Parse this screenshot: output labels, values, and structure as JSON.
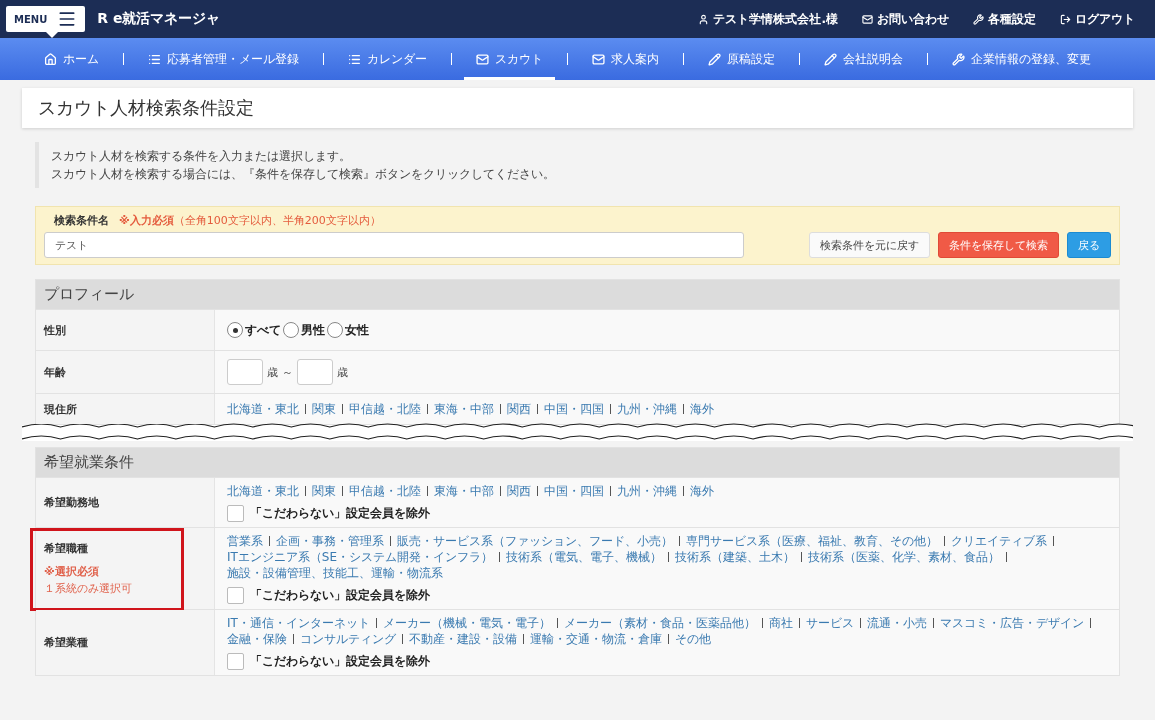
{
  "header": {
    "menu_label": "MENU",
    "app_title": "R e就活マネージャ",
    "links": [
      {
        "label": "テスト学情株式会社.様"
      },
      {
        "label": "お問い合わせ"
      },
      {
        "label": "各種設定"
      },
      {
        "label": "ログアウト"
      }
    ]
  },
  "nav": [
    {
      "label": "ホーム",
      "selected": false
    },
    {
      "label": "応募者管理・メール登録",
      "selected": false
    },
    {
      "label": "カレンダー",
      "selected": false
    },
    {
      "label": "スカウト",
      "selected": true
    },
    {
      "label": "求人案内",
      "selected": false
    },
    {
      "label": "原稿設定",
      "selected": false
    },
    {
      "label": "会社説明会",
      "selected": false
    },
    {
      "label": "企業情報の登録、変更",
      "selected": false
    }
  ],
  "page_title": "スカウト人材検索条件設定",
  "notes": [
    "スカウト人材を検索する条件を入力または選択します。",
    "スカウト人材を検索する場合には、『条件を保存して検索』ボタンをクリックしてください。"
  ],
  "search_name": {
    "label": "検索条件名",
    "required": "※入力必須",
    "hint": "（全角100文字以内、半角200文字以内）",
    "value": "テスト"
  },
  "buttons": [
    {
      "kind": "default",
      "label": "検索条件を元に戻す"
    },
    {
      "kind": "danger",
      "label": "条件を保存して検索"
    },
    {
      "kind": "primary",
      "label": "戻る"
    }
  ],
  "sections": [
    {
      "title": "プロフィール",
      "rows": [
        {
          "kind": "radio",
          "label": "性別",
          "options": [
            {
              "label": "すべて",
              "selected": true
            },
            {
              "label": "男性",
              "selected": false
            },
            {
              "label": "女性",
              "selected": false
            }
          ]
        },
        {
          "kind": "range",
          "label": "年齢",
          "from_unit": "歳",
          "separator": "～",
          "to_unit": "歳"
        },
        {
          "kind": "links",
          "label": "現住所",
          "links": [
            "北海道・東北",
            "関東",
            "甲信越・北陸",
            "東海・中部",
            "関西",
            "中国・四国",
            "九州・沖縄",
            "海外"
          ]
        }
      ]
    },
    {
      "title": "希望就業条件",
      "rows": [
        {
          "kind": "links",
          "label": "希望勤務地",
          "links": [
            "北海道・東北",
            "関東",
            "甲信越・北陸",
            "東海・中部",
            "関西",
            "中国・四国",
            "九州・沖縄",
            "海外"
          ],
          "exclude": {
            "label": "「こだわらない」設定会員を除外",
            "checked": false
          }
        },
        {
          "kind": "links",
          "label": "希望職種",
          "highlighted": true,
          "required": "※選択必須",
          "note": "１系統のみ選択可",
          "links": [
            "営業系",
            "企画・事務・管理系",
            "販売・サービス系（ファッション、フード、小売）",
            "専門サービス系（医療、福祉、教育、その他）",
            "クリエイティブ系",
            "ITエンジニア系（SE・システム開発・インフラ）",
            "技術系（電気、電子、機械）",
            "技術系（建築、土木）",
            "技術系（医薬、化学、素材、食品）",
            "施設・設備管理、技能工、運輸・物流系"
          ],
          "exclude": {
            "label": "「こだわらない」設定会員を除外",
            "checked": false
          }
        },
        {
          "kind": "links",
          "label": "希望業種",
          "links": [
            "IT・通信・インターネット",
            "メーカー（機械・電気・電子）",
            "メーカー（素材・食品・医薬品他）",
            "商社",
            "サービス",
            "流通・小売",
            "マスコミ・広告・デザイン",
            "金融・保険",
            "コンサルティング",
            "不動産・建設・設備",
            "運輸・交通・物流・倉庫",
            "その他"
          ],
          "exclude": {
            "label": "「こだわらない」設定会員を除外",
            "checked": false
          }
        }
      ]
    }
  ]
}
